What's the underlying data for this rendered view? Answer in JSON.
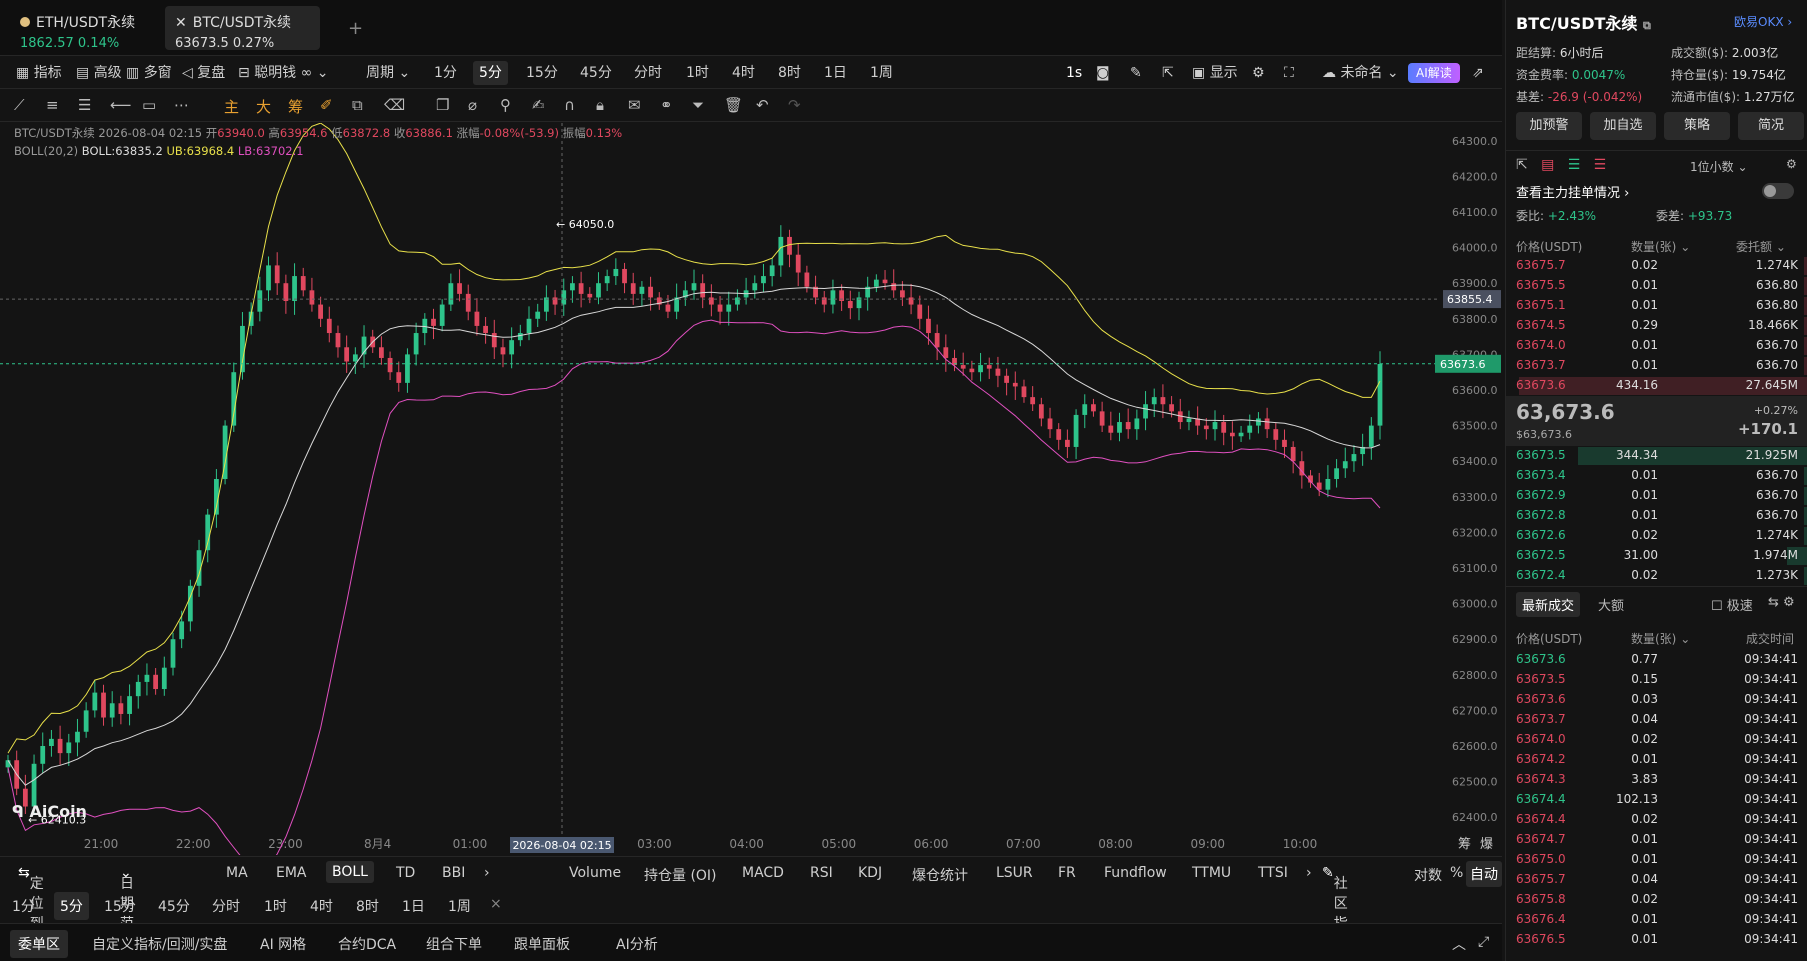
{
  "tabs": [
    {
      "name": "ETH/USDT永续",
      "price": "1862.57",
      "change": "0.14%"
    },
    {
      "name": "BTC/USDT永续",
      "price": "63673.5",
      "change": "0.27%"
    }
  ],
  "toolbar": {
    "indicator": "指标",
    "advanced": "高级",
    "multi": "多窗",
    "replay": "复盘",
    "smart": "聪明钱",
    "period": "周期",
    "intervals": [
      "1分",
      "5分",
      "15分",
      "45分",
      "分时",
      "1时",
      "4时",
      "8时",
      "1日",
      "1周"
    ],
    "active_interval": "5分",
    "second": "1s",
    "display": "显示",
    "unnamed": "未命名",
    "ai": "AI解读"
  },
  "drawing_tools": [
    "主",
    "大",
    "筹"
  ],
  "ohlc": {
    "symbol": "BTC/USDT永续",
    "time": "2026-08-04 02:15",
    "open_label": "开",
    "open": "63940.0",
    "high_label": "高",
    "high": "63954.6",
    "low_label": "低",
    "low": "63872.8",
    "close_label": "收",
    "close": "63886.1",
    "chg_label": "涨幅",
    "chg": "-0.08%(-53.9)",
    "amp_label": "振幅",
    "amp": "0.13%"
  },
  "boll": {
    "label": "BOLL(20,2)",
    "mid": "BOLL:63835.2",
    "ub": "UB:63968.4",
    "lb": "LB:63702.1"
  },
  "chart_data": {
    "type": "candlestick",
    "ylim": [
      62350,
      64350
    ],
    "y_ticks": [
      "64300.0",
      "64200.0",
      "64100.0",
      "64000.0",
      "63900.0",
      "63800.0",
      "63700.0",
      "63600.0",
      "63500.0",
      "63400.0",
      "63300.0",
      "63200.0",
      "63100.0",
      "63000.0",
      "62900.0",
      "62800.0",
      "62700.0",
      "62600.0",
      "62500.0",
      "62400.0"
    ],
    "x_ticks": [
      "21:00",
      "22:00",
      "23:00",
      "8月4",
      "01:00",
      "02:00",
      "03:00",
      "04:00",
      "05:00",
      "06:00",
      "07:00",
      "08:00",
      "09:00",
      "10:00"
    ],
    "crosshair_time": "2026-08-04 02:15",
    "crosshair_price": "63855.4",
    "last_price": "63673.6",
    "high_mark": "64050.0",
    "low_mark": "62410.3",
    "closes": [
      62560,
      62480,
      62430,
      62550,
      62600,
      62620,
      62580,
      62610,
      62640,
      62700,
      62750,
      62680,
      62720,
      62690,
      62740,
      62780,
      62800,
      62760,
      62820,
      62900,
      62950,
      63050,
      63150,
      63250,
      63350,
      63500,
      63650,
      63780,
      63820,
      63880,
      63950,
      63900,
      63850,
      63920,
      63880,
      63840,
      63800,
      63760,
      63720,
      63680,
      63700,
      63750,
      63720,
      63690,
      63650,
      63620,
      63700,
      63760,
      63800,
      63780,
      63840,
      63900,
      63870,
      63820,
      63780,
      63760,
      63720,
      63700,
      63740,
      63760,
      63800,
      63820,
      63860,
      63840,
      63880,
      63900,
      63870,
      63860,
      63900,
      63920,
      63940,
      63900,
      63870,
      63890,
      63860,
      63840,
      63820,
      63860,
      63880,
      63900,
      63860,
      63840,
      63820,
      63840,
      63860,
      63880,
      63900,
      63920,
      63950,
      64030,
      63980,
      63930,
      63890,
      63860,
      63840,
      63880,
      63850,
      63830,
      63860,
      63890,
      63910,
      63900,
      63880,
      63860,
      63840,
      63800,
      63760,
      63720,
      63690,
      63670,
      63660,
      63650,
      63670,
      63660,
      63640,
      63620,
      63610,
      63580,
      63560,
      63520,
      63490,
      63460,
      63440,
      63530,
      63560,
      63540,
      63500,
      63480,
      63510,
      63490,
      63520,
      63560,
      63580,
      63560,
      63540,
      63510,
      63520,
      63500,
      63490,
      63510,
      63480,
      63470,
      63480,
      63500,
      63520,
      63490,
      63460,
      63440,
      63400,
      63360,
      63340,
      63320,
      63350,
      63380,
      63400,
      63420,
      63440,
      63500,
      63673
    ]
  },
  "indicators": [
    "MA",
    "EMA",
    "BOLL",
    "TD",
    "BBI"
  ],
  "active_indicator": "BOLL",
  "locate": "定位到...",
  "date_range": "日期范围",
  "sub_indicators": [
    "Volume",
    "持仓量 (OI)",
    "MACD",
    "RSI",
    "KDJ",
    "爆仓统计",
    "LSUR",
    "FR",
    "Fundflow",
    "TTMU",
    "TTSI"
  ],
  "community": "社区指标",
  "log": "对数",
  "pct": "%",
  "auto": "自动",
  "periods": [
    "1分",
    "5分",
    "15分",
    "45分",
    "分时",
    "1时",
    "4时",
    "8时",
    "1日",
    "1周"
  ],
  "bottom_tabs": [
    "委单区",
    "自定义指标/回测/实盘",
    "AI 网格",
    "合约DCA",
    "组合下单",
    "跟单面板",
    "AI分析"
  ],
  "right": {
    "title": "BTC/USDT永续",
    "exchange": "欧易OKX",
    "settle_label": "距结算:",
    "settle": "6小时后",
    "vol_label": "成交额($):",
    "vol": "2.003亿",
    "fund_label": "资金费率:",
    "fund": "0.0047%",
    "oi_label": "持仓量($):",
    "oi": "19.754亿",
    "basis_label": "基差:",
    "basis": "-26.9 (-0.042%)",
    "mcap_label": "流通市值($):",
    "mcap": "1.27万亿",
    "btns": [
      "加预警",
      "加自选",
      "策略",
      "简况"
    ],
    "decimal": "1位小数",
    "depth": "查看主力挂单情况",
    "ratio_label": "委比:",
    "ratio": "+2.43%",
    "diff_label": "委差:",
    "diff": "+93.73",
    "col_price": "价格(USDT)",
    "col_qty": "数量(张)",
    "col_amt": "委托额",
    "asks": [
      [
        "63675.7",
        "0.02",
        "1.274K"
      ],
      [
        "63675.5",
        "0.01",
        "636.80"
      ],
      [
        "63675.1",
        "0.01",
        "636.80"
      ],
      [
        "63674.5",
        "0.29",
        "18.466K"
      ],
      [
        "63674.0",
        "0.01",
        "636.70"
      ],
      [
        "63673.7",
        "0.01",
        "636.70"
      ],
      [
        "63673.6",
        "434.16",
        "27.645M"
      ]
    ],
    "mid_price": "63,673.6",
    "mid_usd": "$63,673.6",
    "mid_pct": "+0.27%",
    "mid_chg": "+170.1",
    "bids": [
      [
        "63673.5",
        "344.34",
        "21.925M"
      ],
      [
        "63673.4",
        "0.01",
        "636.70"
      ],
      [
        "63672.9",
        "0.01",
        "636.70"
      ],
      [
        "63672.8",
        "0.01",
        "636.70"
      ],
      [
        "63672.6",
        "0.02",
        "1.274K"
      ],
      [
        "63672.5",
        "31.00",
        "1.974M"
      ],
      [
        "63672.4",
        "0.02",
        "1.273K"
      ]
    ],
    "trades_tab": "最新成交",
    "big_tab": "大额",
    "fast": "极速",
    "col_time": "成交时间",
    "trades": [
      [
        "63673.6",
        "0.77",
        "09:34:41",
        "g"
      ],
      [
        "63673.5",
        "0.15",
        "09:34:41",
        "r"
      ],
      [
        "63673.6",
        "0.03",
        "09:34:41",
        "r"
      ],
      [
        "63673.7",
        "0.04",
        "09:34:41",
        "r"
      ],
      [
        "63674.0",
        "0.02",
        "09:34:41",
        "r"
      ],
      [
        "63674.2",
        "0.01",
        "09:34:41",
        "r"
      ],
      [
        "63674.3",
        "3.83",
        "09:34:41",
        "r"
      ],
      [
        "63674.4",
        "102.13",
        "09:34:41",
        "g"
      ],
      [
        "63674.4",
        "0.02",
        "09:34:41",
        "r"
      ],
      [
        "63674.7",
        "0.01",
        "09:34:41",
        "r"
      ],
      [
        "63675.0",
        "0.01",
        "09:34:41",
        "r"
      ],
      [
        "63675.7",
        "0.04",
        "09:34:41",
        "r"
      ],
      [
        "63675.8",
        "0.02",
        "09:34:41",
        "r"
      ],
      [
        "63676.4",
        "0.01",
        "09:34:41",
        "r"
      ],
      [
        "63676.5",
        "0.01",
        "09:34:41",
        "r"
      ]
    ]
  },
  "colors": {
    "up": "#2ec48b",
    "down": "#e0485f",
    "ub": "#e8e04a",
    "lb": "#e050c0",
    "mid": "#d8d8d8"
  }
}
